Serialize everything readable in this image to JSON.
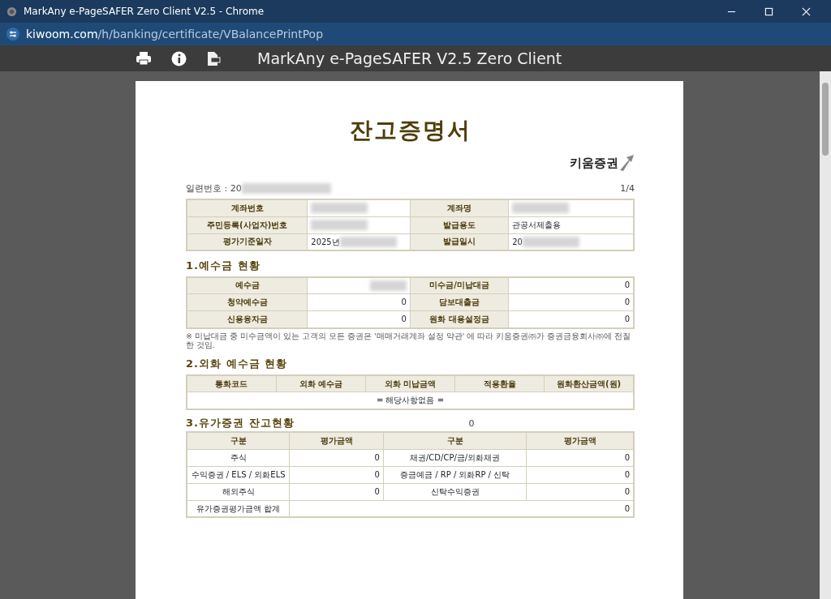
{
  "window": {
    "title": "MarkAny e-PageSAFER Zero Client V2.5 - Chrome"
  },
  "address": {
    "host": "kiwoom.com",
    "path": "/h/banking/certificate/VBalancePrintPop"
  },
  "viewer": {
    "title": "MarkAny e-PageSAFER V2.5 Zero Client"
  },
  "document": {
    "title": "잔고증명서",
    "brand": "키움증권",
    "serial": {
      "label": "일련번호 : 20",
      "redacted": true
    },
    "page": "1/4",
    "info_rows": [
      [
        {
          "label": "계좌번호",
          "redacted": true
        },
        {
          "label": "계좌명",
          "redacted": true
        }
      ],
      [
        {
          "label": "주민등록(사업자)번호",
          "redacted": true
        },
        {
          "label": "발급용도",
          "value": "관공서제출용"
        }
      ],
      [
        {
          "label": "평가기준일자",
          "value": "2025년",
          "redacted": true
        },
        {
          "label": "발급일시",
          "value": "20",
          "redacted": true
        }
      ]
    ],
    "deposit": {
      "title": "1.예수금 현황",
      "rows": [
        [
          {
            "label": "예수금",
            "redacted": true
          },
          {
            "label": "미수금/미납대금",
            "value": "0"
          }
        ],
        [
          {
            "label": "청약예수금",
            "value": "0"
          },
          {
            "label": "담보대출금",
            "value": "0"
          }
        ],
        [
          {
            "label": "신용융자금",
            "value": "0"
          },
          {
            "label": "원화 대용설정금",
            "value": "0"
          }
        ]
      ],
      "note": "※ 미납대금 중 미수금액이 있는 고객의 모든 증권은 '매매거래계좌 설정 약관' 에 따라 키움증권㈜가 증권금융회사㈜에 전질한 것임."
    },
    "foreign": {
      "title": "2.외화 예수금 현황",
      "columns": [
        "통화코드",
        "외화 예수금",
        "외화 미납금액",
        "적용환율",
        "원화환산금액(원)"
      ],
      "empty_text": "= 해당사항없음 ="
    },
    "securities": {
      "title": "3.유가증권 잔고현황",
      "stray_value": "0",
      "columns": [
        "구분",
        "평가금액",
        "구분",
        "평가금액"
      ],
      "rows": [
        [
          "주식",
          "0",
          "채권/CD/CP/금/외화채권",
          "0"
        ],
        [
          "수익증권 / ELS / 외화ELS",
          "0",
          "증금예금 / RP / 외화RP / 신탁",
          "0"
        ],
        [
          "해외주식",
          "0",
          "신탁수익증권",
          "0"
        ]
      ],
      "total": {
        "label": "유가증권평가금액 합계",
        "value": "0"
      }
    }
  }
}
